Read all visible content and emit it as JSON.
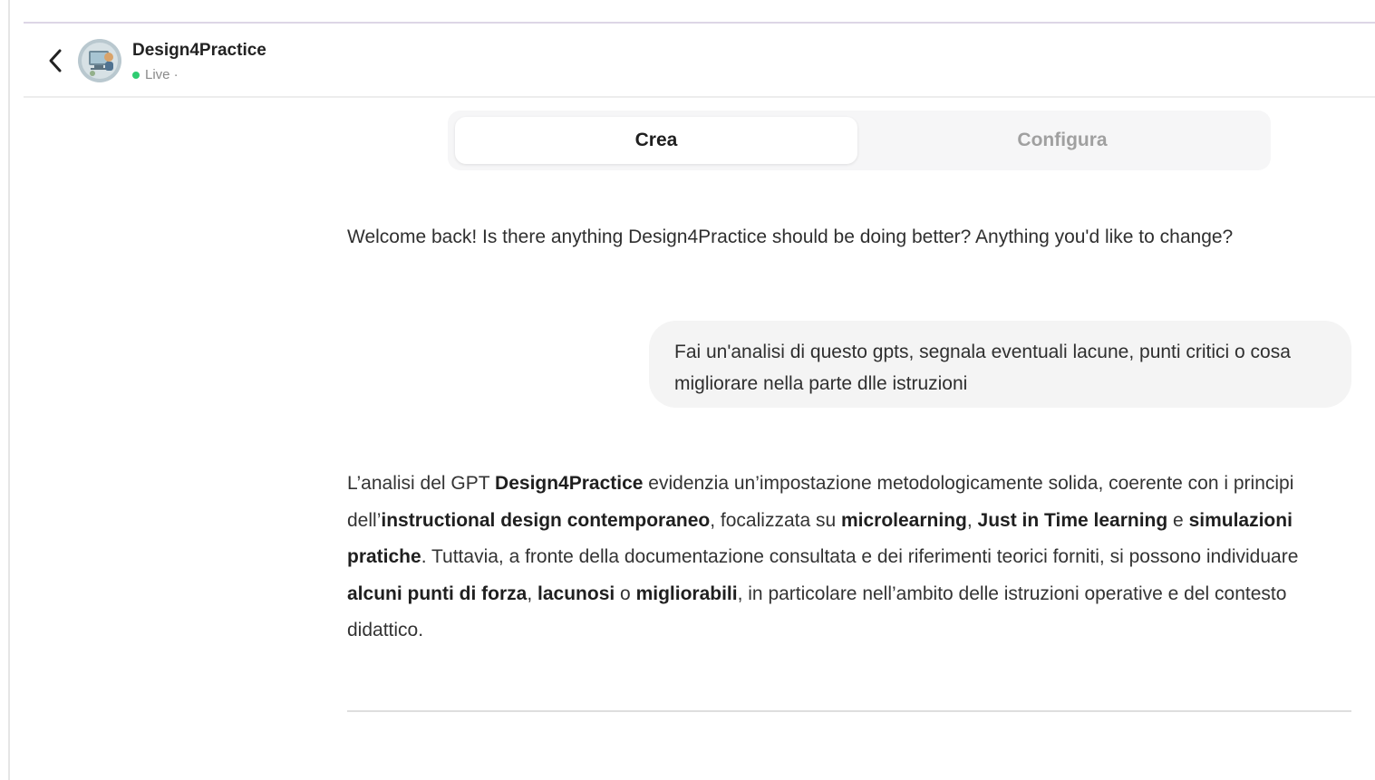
{
  "header": {
    "gpt_name": "Design4Practice",
    "status": "Live ·",
    "status_color": "#2ecc71"
  },
  "icons": {
    "back": "chevron-left-icon",
    "avatar": "gpt-avatar-image"
  },
  "tabs": [
    {
      "label": "Crea",
      "active": true
    },
    {
      "label": "Configura",
      "active": false
    }
  ],
  "conversation": {
    "assistant_welcome": "Welcome back! Is there anything Design4Practice should be doing better? Anything you'd like to change?",
    "user_message": "Fai un'analisi di questo gpts, segnala eventuali lacune, punti critici o cosa migliorare nella parte dlle istruzioni",
    "assistant_reply": [
      {
        "text": "L’analisi del GPT ",
        "bold": false
      },
      {
        "text": "Design4Practice",
        "bold": true
      },
      {
        "text": " evidenzia un’impostazione metodologicamente solida, coerente con i principi dell’",
        "bold": false
      },
      {
        "text": "instructional design contemporaneo",
        "bold": true
      },
      {
        "text": ", focalizzata su ",
        "bold": false
      },
      {
        "text": "microlearning",
        "bold": true
      },
      {
        "text": ", ",
        "bold": false
      },
      {
        "text": "Just in Time learning",
        "bold": true
      },
      {
        "text": " e ",
        "bold": false
      },
      {
        "text": "simulazioni pratiche",
        "bold": true
      },
      {
        "text": ". Tuttavia, a fronte della documentazione consultata e dei riferimenti teorici forniti, si possono individuare ",
        "bold": false
      },
      {
        "text": "alcuni punti di forza",
        "bold": true
      },
      {
        "text": ", ",
        "bold": false
      },
      {
        "text": "lacunosi",
        "bold": true
      },
      {
        "text": " o ",
        "bold": false
      },
      {
        "text": "migliorabili",
        "bold": true
      },
      {
        "text": ", in particolare nell’ambito delle istruzioni operative e del contesto didattico.",
        "bold": false
      }
    ]
  }
}
